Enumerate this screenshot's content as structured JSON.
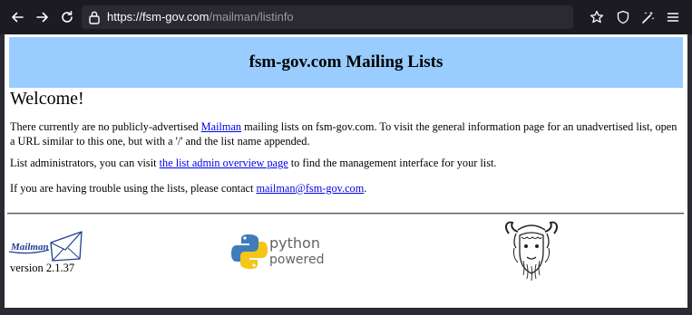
{
  "browser": {
    "url_host": "https://fsm-gov.com",
    "url_path": "/mailman/listinfo"
  },
  "page": {
    "banner_title": "fsm-gov.com Mailing Lists",
    "welcome_heading": "Welcome!",
    "p1_before": "There currently are no publicly-advertised ",
    "p1_link": "Mailman",
    "p1_after": " mailing lists on fsm-gov.com. To visit the general information page for an unadvertised list, open a URL similar to this one, but with a '/' and the list name appended.",
    "p2_before": "List administrators, you can visit ",
    "p2_link": "the list admin overview page",
    "p2_after": " to find the management interface for your list.",
    "p3_before": "If you are having trouble using the lists, please contact ",
    "p3_link": "mailman@fsm-gov.com",
    "p3_after": ".",
    "mailman_logo_text": "Mailman",
    "version": "version 2.1.37",
    "python_word": "python",
    "powered_word": "powered"
  },
  "colors": {
    "banner_bg": "#99ccff",
    "link": "#0000ee",
    "toolbar_bg": "#1c1b22"
  },
  "icons": [
    "back-icon",
    "forward-icon",
    "reload-icon",
    "lock-icon",
    "bookmark-star-icon",
    "shield-icon",
    "extensions-icon",
    "menu-icon"
  ]
}
